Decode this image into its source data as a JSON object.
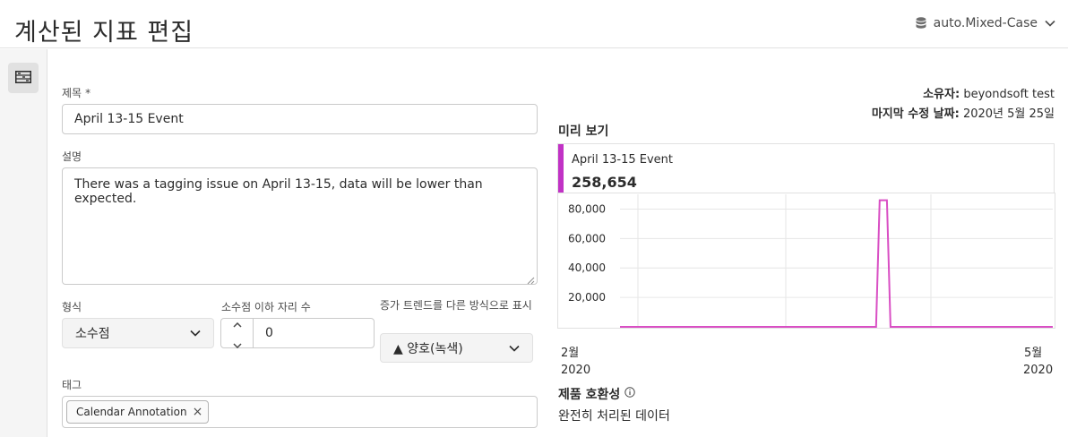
{
  "header": {
    "title": "계산된 지표 편집",
    "report_suite": "auto.Mixed-Case"
  },
  "leftrail": {
    "builder_icon": "calculator-builder-icon"
  },
  "form": {
    "title_label": "제목",
    "title_required_mark": "*",
    "title_value": "April 13-15 Event",
    "description_label": "설명",
    "description_value": "There was a tagging issue on April 13-15, data will be lower than expected.",
    "format_label": "형식",
    "format_value": "소수점",
    "decimals_label": "소수점 이하 자리 수",
    "decimals_value": "0",
    "trend_label": "증가 트렌드를 다른 방식으로 표시",
    "trend_value": "▲ 양호(녹색)",
    "tags_label": "태그",
    "tags": [
      "Calendar Annotation"
    ]
  },
  "meta": {
    "owner_label": "소유자:",
    "owner_value": "beyondsoft test",
    "modified_label": "마지막 수정 날짜:",
    "modified_value": "2020년 5월 25일"
  },
  "preview": {
    "title": "미리 보기",
    "metric_name": "April 13-15 Event",
    "metric_total": "258,654",
    "accent_color": "#c132c5"
  },
  "chart_data": {
    "type": "line",
    "x_ticks": [
      {
        "month": "2월",
        "year": "2020"
      },
      {
        "month": "5월",
        "year": "2020"
      }
    ],
    "y_ticks": [
      "20,000",
      "40,000",
      "60,000",
      "80,000"
    ],
    "ylim": [
      0,
      90000
    ],
    "x_range": [
      "2020-02-01",
      "2020-05-31"
    ],
    "grid": true,
    "series": [
      {
        "color": "#d94fc4",
        "points": [
          {
            "x": "2020-02-01",
            "y": 0
          },
          {
            "x": "2020-04-12",
            "y": 0
          },
          {
            "x": "2020-04-13",
            "y": 86000
          },
          {
            "x": "2020-04-15",
            "y": 86000
          },
          {
            "x": "2020-04-16",
            "y": 0
          },
          {
            "x": "2020-05-31",
            "y": 0
          }
        ]
      }
    ]
  },
  "compat": {
    "title": "제품 호환성",
    "info_icon": "info-icon",
    "value": "완전히 처리된 데이터"
  }
}
